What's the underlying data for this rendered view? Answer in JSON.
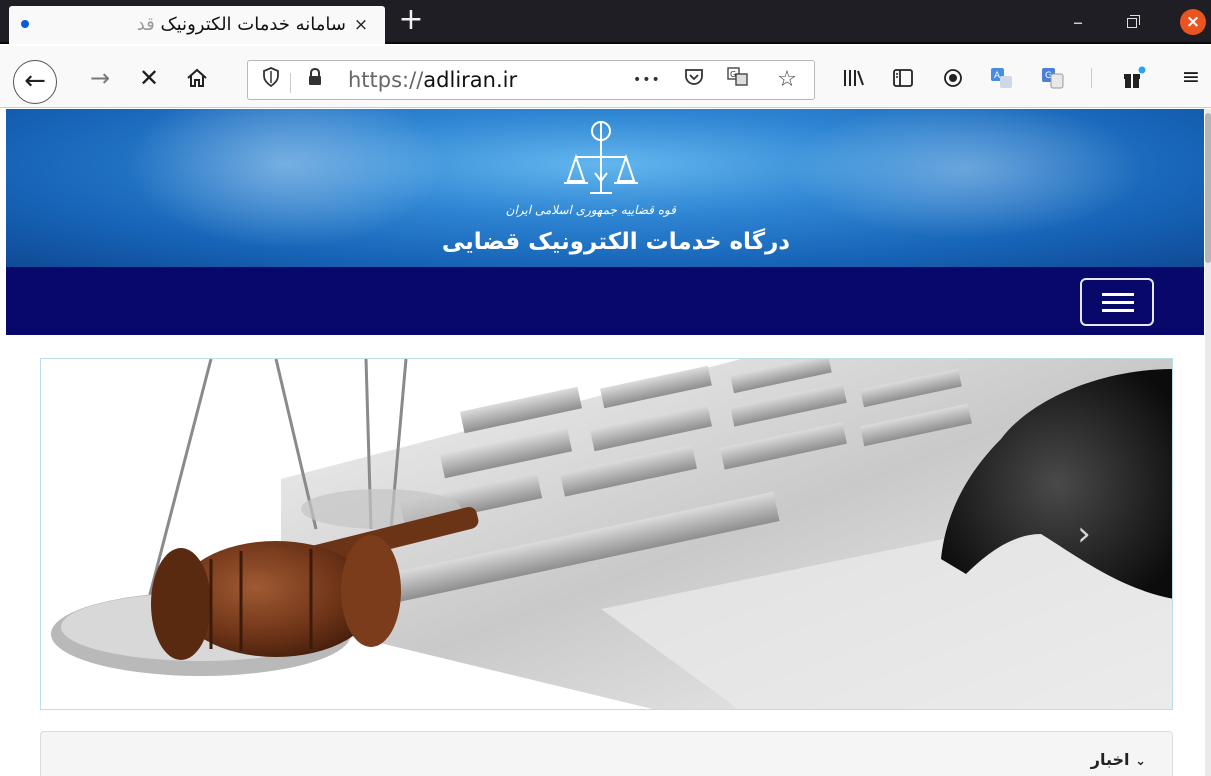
{
  "browser": {
    "tab": {
      "title": "سامانه خدمات الکترونیک",
      "title_fade": "قد",
      "close": "×"
    },
    "new_tab": "+",
    "window": {
      "minimize": "–",
      "close": "×"
    },
    "url": {
      "scheme": "https://",
      "host": "adliran.ir"
    },
    "more": "•••"
  },
  "header": {
    "tagline": "قوه قضاییه جمهوری اسلامی ایران",
    "title": "درگاه خدمات الکترونیک قضایی"
  },
  "slider": {
    "prev": "‹",
    "next": "›"
  },
  "news": {
    "title": "اخبار",
    "chevron": "⌄"
  },
  "colors": {
    "banner_blue": "#1764b8",
    "navbar_navy": "#08086a",
    "close_orange": "#e95420"
  }
}
